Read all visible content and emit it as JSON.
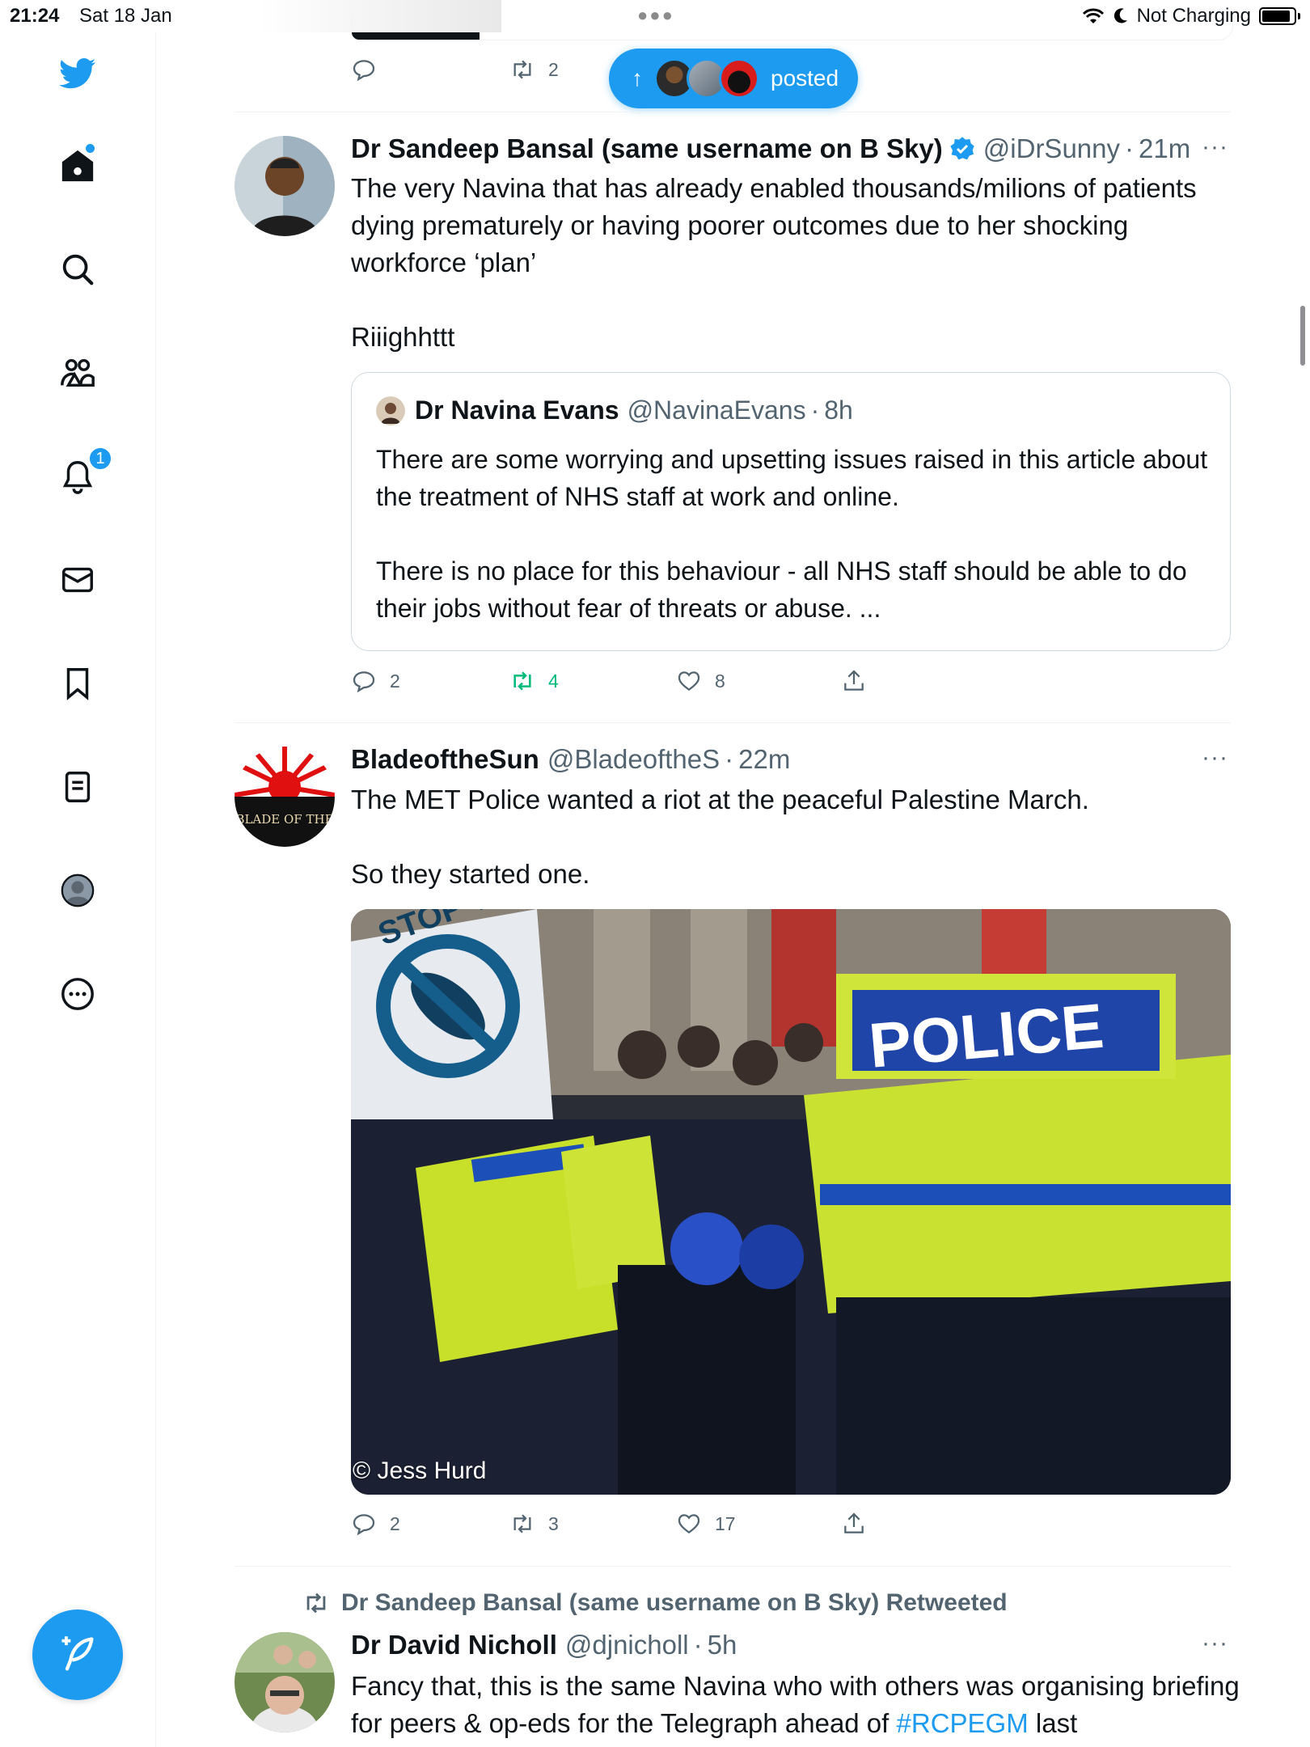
{
  "status_bar": {
    "time": "21:24",
    "date": "Sat 18 Jan",
    "charging": "Not Charging"
  },
  "sidebar": {
    "items": [
      {
        "icon": "twitter-bird-icon"
      },
      {
        "icon": "home-icon"
      },
      {
        "icon": "search-icon"
      },
      {
        "icon": "communities-icon"
      },
      {
        "icon": "notifications-icon",
        "badge": "1"
      },
      {
        "icon": "messages-icon"
      },
      {
        "icon": "bookmarks-icon"
      },
      {
        "icon": "lists-icon"
      },
      {
        "icon": "profile-icon"
      },
      {
        "icon": "more-icon"
      }
    ]
  },
  "new_posts_pill": {
    "label": "posted"
  },
  "top_tweet": {
    "replies": "",
    "retweets": "2"
  },
  "tweets": [
    {
      "name": "Dr Sandeep Bansal (same username on B Sky)",
      "verified": true,
      "handle": "@iDrSunny",
      "time": "21m",
      "text": "The very Navina that has already enabled thousands/milions of patients dying prematurely or having poorer outcomes due to her shocking workforce ‘plan’\n\nRiiighhttt",
      "quote": {
        "name": "Dr Navina Evans",
        "handle": "@NavinaEvans",
        "time": "8h",
        "text": "There are some worrying and upsetting issues raised in this article about the treatment of NHS staff at work and online.\n\nThere is no place for this behaviour - all NHS staff should be able to do their jobs without fear of threats or abuse. ..."
      },
      "replies": "2",
      "retweets": "4",
      "likes": "8"
    },
    {
      "name": "BladeoftheSun",
      "verified": false,
      "handle": "@BladeoftheS",
      "time": "22m",
      "avatar_text": "BLADE OF THE",
      "text": "The MET Police wanted a riot at the peaceful Palestine March.\n\nSo they started one.",
      "media_credit": "© Jess Hurd",
      "media_sign_text": "STOP THE WAR",
      "media_vest_text": "POLICE",
      "replies": "2",
      "retweets": "3",
      "likes": "17"
    },
    {
      "retweeted_by": "Dr Sandeep Bansal (same username on B Sky) Retweeted",
      "name": "Dr David Nicholl",
      "handle": "@djnicholl",
      "time": "5h",
      "text_before": "Fancy that, this is the same Navina who with others was organising briefing for peers & op-eds for the Telegraph ahead of ",
      "hashtag": "#RCPEGM",
      "text_after": " last"
    }
  ],
  "colors": {
    "accent": "#1d9bf0",
    "retweet_active": "#00ba7c",
    "secondary_text": "#536471",
    "border": "#eff3f4"
  }
}
